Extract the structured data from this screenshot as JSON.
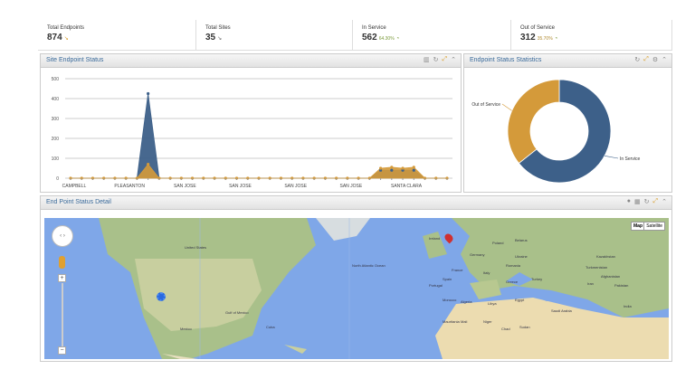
{
  "kpis": [
    {
      "label": "Total Endpoints",
      "value": "874",
      "pct": ""
    },
    {
      "label": "Total Sites",
      "value": "35",
      "pct": ""
    },
    {
      "label": "In Service",
      "value": "562",
      "pct": "64.30%"
    },
    {
      "label": "Out of Service",
      "value": "312",
      "pct": "35.70%"
    }
  ],
  "panels": {
    "site": {
      "title": "Site Endpoint Status",
      "tools": [
        "chart-icon",
        "refresh-icon",
        "expand-icon",
        "collapse-icon"
      ]
    },
    "stats": {
      "title": "Endpoint Status Statistics",
      "tools": [
        "refresh-icon",
        "expand-icon",
        "settings-icon",
        "collapse-icon"
      ]
    },
    "detail": {
      "title": "End Point Status Detail",
      "tools": [
        "globe-icon",
        "grid-icon",
        "refresh-icon",
        "expand-icon",
        "collapse-icon"
      ]
    }
  },
  "map": {
    "buttons": [
      "Map",
      "Satellite"
    ],
    "labels": [
      "United States",
      "Mexico",
      "North Atlantic Ocean",
      "Gulf of Mexico",
      "Cuba",
      "Ireland",
      "France",
      "Spain",
      "Portugal",
      "Germany",
      "Poland",
      "Belarus",
      "Ukraine",
      "Romania",
      "Italy",
      "Greece",
      "Turkey",
      "Kazakhstan",
      "Turkmenistan",
      "Iran",
      "Afghanistan",
      "Pakistan",
      "India",
      "Algeria",
      "Libya",
      "Egypt",
      "Saudi Arabia",
      "Mauritania",
      "Mali",
      "Niger",
      "Chad",
      "Sudan",
      "Morocco"
    ]
  },
  "chart_data": [
    {
      "type": "area",
      "ylim": [
        0,
        500
      ],
      "yticks": [
        0,
        100,
        200,
        300,
        400,
        500
      ],
      "grid": true,
      "tick_labels": [
        {
          "index": 0,
          "label": "CAMPBELL"
        },
        {
          "index": 5,
          "label": "PLEASANTON"
        },
        {
          "index": 10,
          "label": "SAN JOSE"
        },
        {
          "index": 15,
          "label": "SAN JOSE"
        },
        {
          "index": 20,
          "label": "SAN JOSE"
        },
        {
          "index": 25,
          "label": "SAN JOSE"
        },
        {
          "index": 30,
          "label": "SANTA CLARA"
        }
      ],
      "point_count": 35,
      "series": [
        {
          "color": "#3d6089",
          "values": [
            0,
            0,
            0,
            0,
            0,
            0,
            0,
            425,
            0,
            0,
            0,
            0,
            0,
            0,
            0,
            0,
            0,
            0,
            0,
            0,
            0,
            0,
            0,
            0,
            0,
            0,
            0,
            0,
            40,
            40,
            40,
            40,
            0,
            0,
            0
          ]
        },
        {
          "color": "#d49a3a",
          "values": [
            0,
            0,
            0,
            0,
            0,
            0,
            0,
            70,
            0,
            0,
            0,
            0,
            0,
            0,
            0,
            0,
            0,
            0,
            0,
            0,
            0,
            0,
            0,
            0,
            0,
            0,
            0,
            0,
            50,
            55,
            50,
            55,
            0,
            0,
            0
          ]
        }
      ]
    },
    {
      "type": "pie",
      "donut": true,
      "slices": [
        {
          "label": "In Service",
          "value": 562,
          "color": "#3d6089"
        },
        {
          "label": "Out of Service",
          "value": 312,
          "color": "#d49a3a"
        }
      ]
    }
  ]
}
